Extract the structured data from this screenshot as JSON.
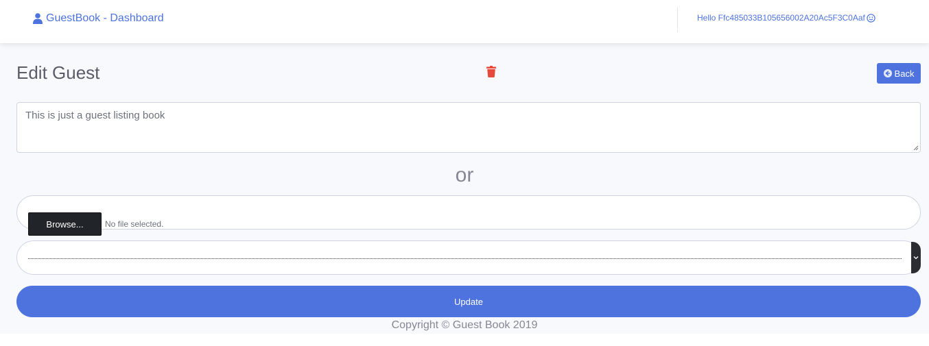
{
  "navbar": {
    "brand_label": "GuestBook - Dashboard",
    "brand_icon": "user-icon",
    "greeting": "Hello Ffc485033B105656002A20Ac5F3C0Aaf",
    "greeting_icon": "smile-icon"
  },
  "page": {
    "title": "Edit Guest",
    "delete_icon": "trash-icon",
    "back_label": "Back",
    "back_icon": "arrow-circle-left-icon"
  },
  "form": {
    "message_value": "This is just a guest listing book",
    "or_label": "or",
    "browse_label": "Browse...",
    "file_status": "No file selected.",
    "select_value": "",
    "update_label": "Update"
  },
  "footer": {
    "copyright": "Copyright © Guest Book 2019"
  },
  "colors": {
    "primary": "#4e73df",
    "danger": "#e74a3b",
    "background": "#f8f9fc",
    "text_muted": "#858796"
  }
}
